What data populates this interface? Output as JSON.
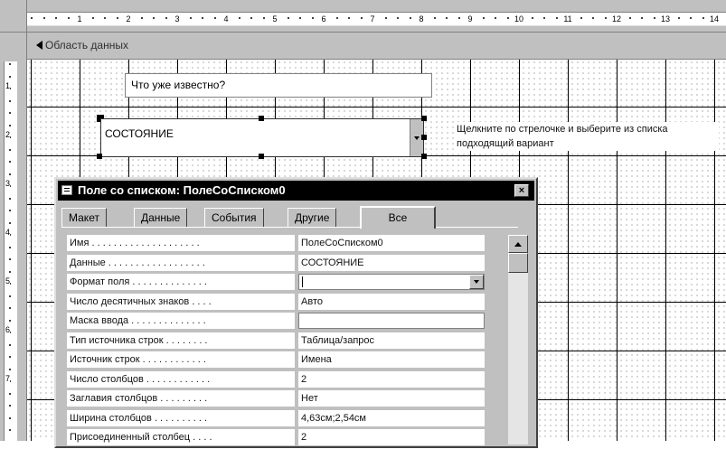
{
  "ruler": {
    "h_numbers": [
      "1",
      "2",
      "3",
      "4",
      "5",
      "6",
      "7",
      "8",
      "9",
      "10",
      "11",
      "12",
      "13",
      "14"
    ],
    "v_numbers": [
      "1",
      "2",
      "3",
      "4",
      "5",
      "6",
      "7"
    ]
  },
  "section": {
    "label": "Область данных"
  },
  "design": {
    "label_known": "Что уже известно?",
    "combo_value": "СОСТОЯНИЕ",
    "hint": "Щелкните по стрелочке и выберите из списка подходящий вариант"
  },
  "property_sheet": {
    "title": "Поле со списком: ПолеСоСписком0",
    "close_glyph": "×",
    "tabs": [
      {
        "label": "Макет",
        "active": false
      },
      {
        "label": "Данные",
        "active": false
      },
      {
        "label": "События",
        "active": false
      },
      {
        "label": "Другие",
        "active": false
      },
      {
        "label": "Все",
        "active": true
      }
    ],
    "rows": [
      {
        "name": "Имя . . . . . . . . . . . . . . . . . . . .",
        "value": "ПолеСоСписком0"
      },
      {
        "name": "Данные . . . . . . . . . . . . . . . . . .",
        "value": "СОСТОЯНИЕ"
      },
      {
        "name": "Формат поля . . . . . . . . . . . . . .",
        "value": ""
      },
      {
        "name": "Число десятичных знаков . . . .",
        "value": "Авто"
      },
      {
        "name": "Маска ввода . . . . . . . . . . . . . .",
        "value": ""
      },
      {
        "name": "Тип источника строк . . . . . . . .",
        "value": "Таблица/запрос"
      },
      {
        "name": "Источник строк . . . . . . . . . . . .",
        "value": "Имена"
      },
      {
        "name": "Число столбцов . . . . . . . . . . . .",
        "value": "2"
      },
      {
        "name": "Заглавия столбцов . . . . . . . . .",
        "value": "Нет"
      },
      {
        "name": "Ширина столбцов . . . . . . . . . .",
        "value": "4,63см;2,54см"
      },
      {
        "name": "Присоединенный столбец . . . .",
        "value": "2"
      }
    ]
  },
  "colors": {
    "chrome": "#c0c0c0",
    "titlebar": "#000000",
    "grid_line": "#000000",
    "canvas": "#ffffff"
  },
  "icons": {
    "section": "triangle-left-icon",
    "combo_drop": "chevron-down-icon",
    "window": "form-window-icon",
    "close": "close-icon"
  }
}
